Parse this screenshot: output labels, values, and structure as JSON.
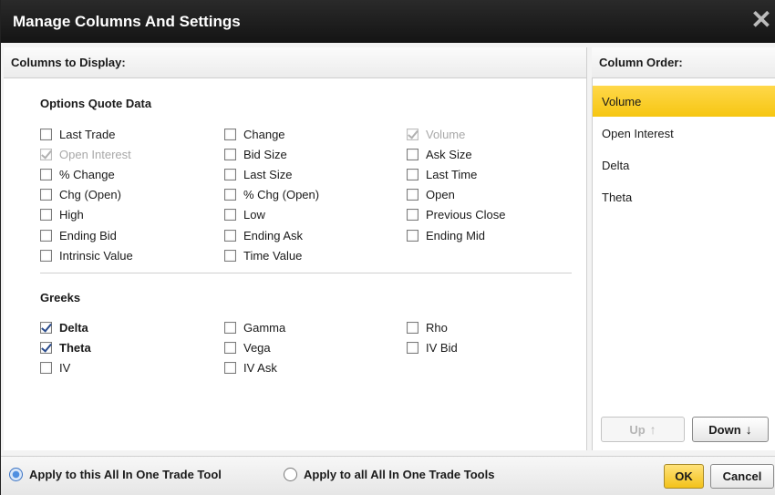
{
  "dialog": {
    "title": "Manage Columns And Settings",
    "close_glyph": "✕"
  },
  "left_panel": {
    "header": "Columns to Display:",
    "sections": [
      {
        "title": "Options Quote Data",
        "columns": [
          [
            {
              "label": "Last Trade",
              "checked": false,
              "disabled": false
            },
            {
              "label": "Open Interest",
              "checked": true,
              "disabled": true
            },
            {
              "label": "% Change",
              "checked": false,
              "disabled": false
            },
            {
              "label": "Chg (Open)",
              "checked": false,
              "disabled": false
            },
            {
              "label": "High",
              "checked": false,
              "disabled": false
            },
            {
              "label": "Ending Bid",
              "checked": false,
              "disabled": false
            },
            {
              "label": "Intrinsic Value",
              "checked": false,
              "disabled": false
            }
          ],
          [
            {
              "label": "Change",
              "checked": false,
              "disabled": false
            },
            {
              "label": "Bid Size",
              "checked": false,
              "disabled": false
            },
            {
              "label": "Last Size",
              "checked": false,
              "disabled": false
            },
            {
              "label": "% Chg (Open)",
              "checked": false,
              "disabled": false
            },
            {
              "label": "Low",
              "checked": false,
              "disabled": false
            },
            {
              "label": "Ending Ask",
              "checked": false,
              "disabled": false
            },
            {
              "label": "Time Value",
              "checked": false,
              "disabled": false
            }
          ],
          [
            {
              "label": "Volume",
              "checked": true,
              "disabled": true
            },
            {
              "label": "Ask Size",
              "checked": false,
              "disabled": false
            },
            {
              "label": "Last Time",
              "checked": false,
              "disabled": false
            },
            {
              "label": "Open",
              "checked": false,
              "disabled": false
            },
            {
              "label": "Previous Close",
              "checked": false,
              "disabled": false
            },
            {
              "label": "Ending Mid",
              "checked": false,
              "disabled": false
            }
          ]
        ]
      },
      {
        "title": "Greeks",
        "columns": [
          [
            {
              "label": "Delta",
              "checked": true,
              "disabled": false
            },
            {
              "label": "Theta",
              "checked": true,
              "disabled": false
            },
            {
              "label": "IV",
              "checked": false,
              "disabled": false
            }
          ],
          [
            {
              "label": "Gamma",
              "checked": false,
              "disabled": false
            },
            {
              "label": "Vega",
              "checked": false,
              "disabled": false
            },
            {
              "label": "IV Ask",
              "checked": false,
              "disabled": false
            }
          ],
          [
            {
              "label": "Rho",
              "checked": false,
              "disabled": false
            },
            {
              "label": "IV Bid",
              "checked": false,
              "disabled": false
            }
          ]
        ]
      }
    ]
  },
  "right_panel": {
    "header": "Column Order:",
    "items": [
      {
        "label": "Volume",
        "selected": true
      },
      {
        "label": "Open Interest",
        "selected": false
      },
      {
        "label": "Delta",
        "selected": false
      },
      {
        "label": "Theta",
        "selected": false
      }
    ],
    "up_label": "Up",
    "up_arrow": "↑",
    "up_disabled": true,
    "down_label": "Down",
    "down_arrow": "↓"
  },
  "footer": {
    "radio_this": "Apply to this All In One Trade Tool",
    "radio_this_checked": true,
    "radio_all": "Apply to all All In One Trade Tools",
    "radio_all_checked": false,
    "ok_label": "OK",
    "cancel_label": "Cancel"
  },
  "colors": {
    "titlebar": "#1c1c1c",
    "selected_row": "#f8cc1f",
    "ok_button": "#f3c21a"
  }
}
